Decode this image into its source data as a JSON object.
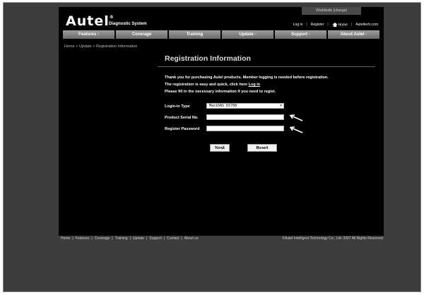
{
  "worldwide_label": "Worldwide [change]",
  "logo": {
    "brand": "Autel",
    "reg_mark": "®",
    "tagline": "Diagnostic System"
  },
  "top_links": {
    "login": "Log in",
    "register": "Register",
    "home": "Home",
    "site": "Auteltech.com",
    "separator": "|"
  },
  "nav_tabs": [
    "Features -",
    "Coverage",
    "Training",
    "Update -",
    "Support -",
    "About Autel -"
  ],
  "breadcrumb": "Home > Update > Registration Information",
  "page_title": "Registration Information",
  "intro": {
    "line1": "Thank you for purchasing Autel products. Member logging is needed before registration.",
    "line2_prefix": "The registration is easy and quick, click here",
    "line2_link": "Log in",
    "line3": "Please fill in the necessary information if you need to regist."
  },
  "form": {
    "login_type_label": "Login-in Type",
    "login_type_value": "MaxiDAS DS708",
    "serial_label": "Product Serial No.",
    "serial_value": "",
    "password_label": "Register Password",
    "password_value": ""
  },
  "buttons": {
    "next": "Next",
    "reset": "Reset"
  },
  "footer": {
    "links": [
      "Home",
      "Features",
      "Coverage",
      "Training",
      "Update",
      "Support",
      "Contact",
      "About us"
    ],
    "separator": "|",
    "copyright": "©Autel Intelligent Technology Co., Ltd. 2007 All Rights Reserved."
  },
  "colors": {
    "site_bg": "#000000",
    "outer_bg": "#3c3c3c",
    "nav_tab": "#8a8a8a"
  }
}
